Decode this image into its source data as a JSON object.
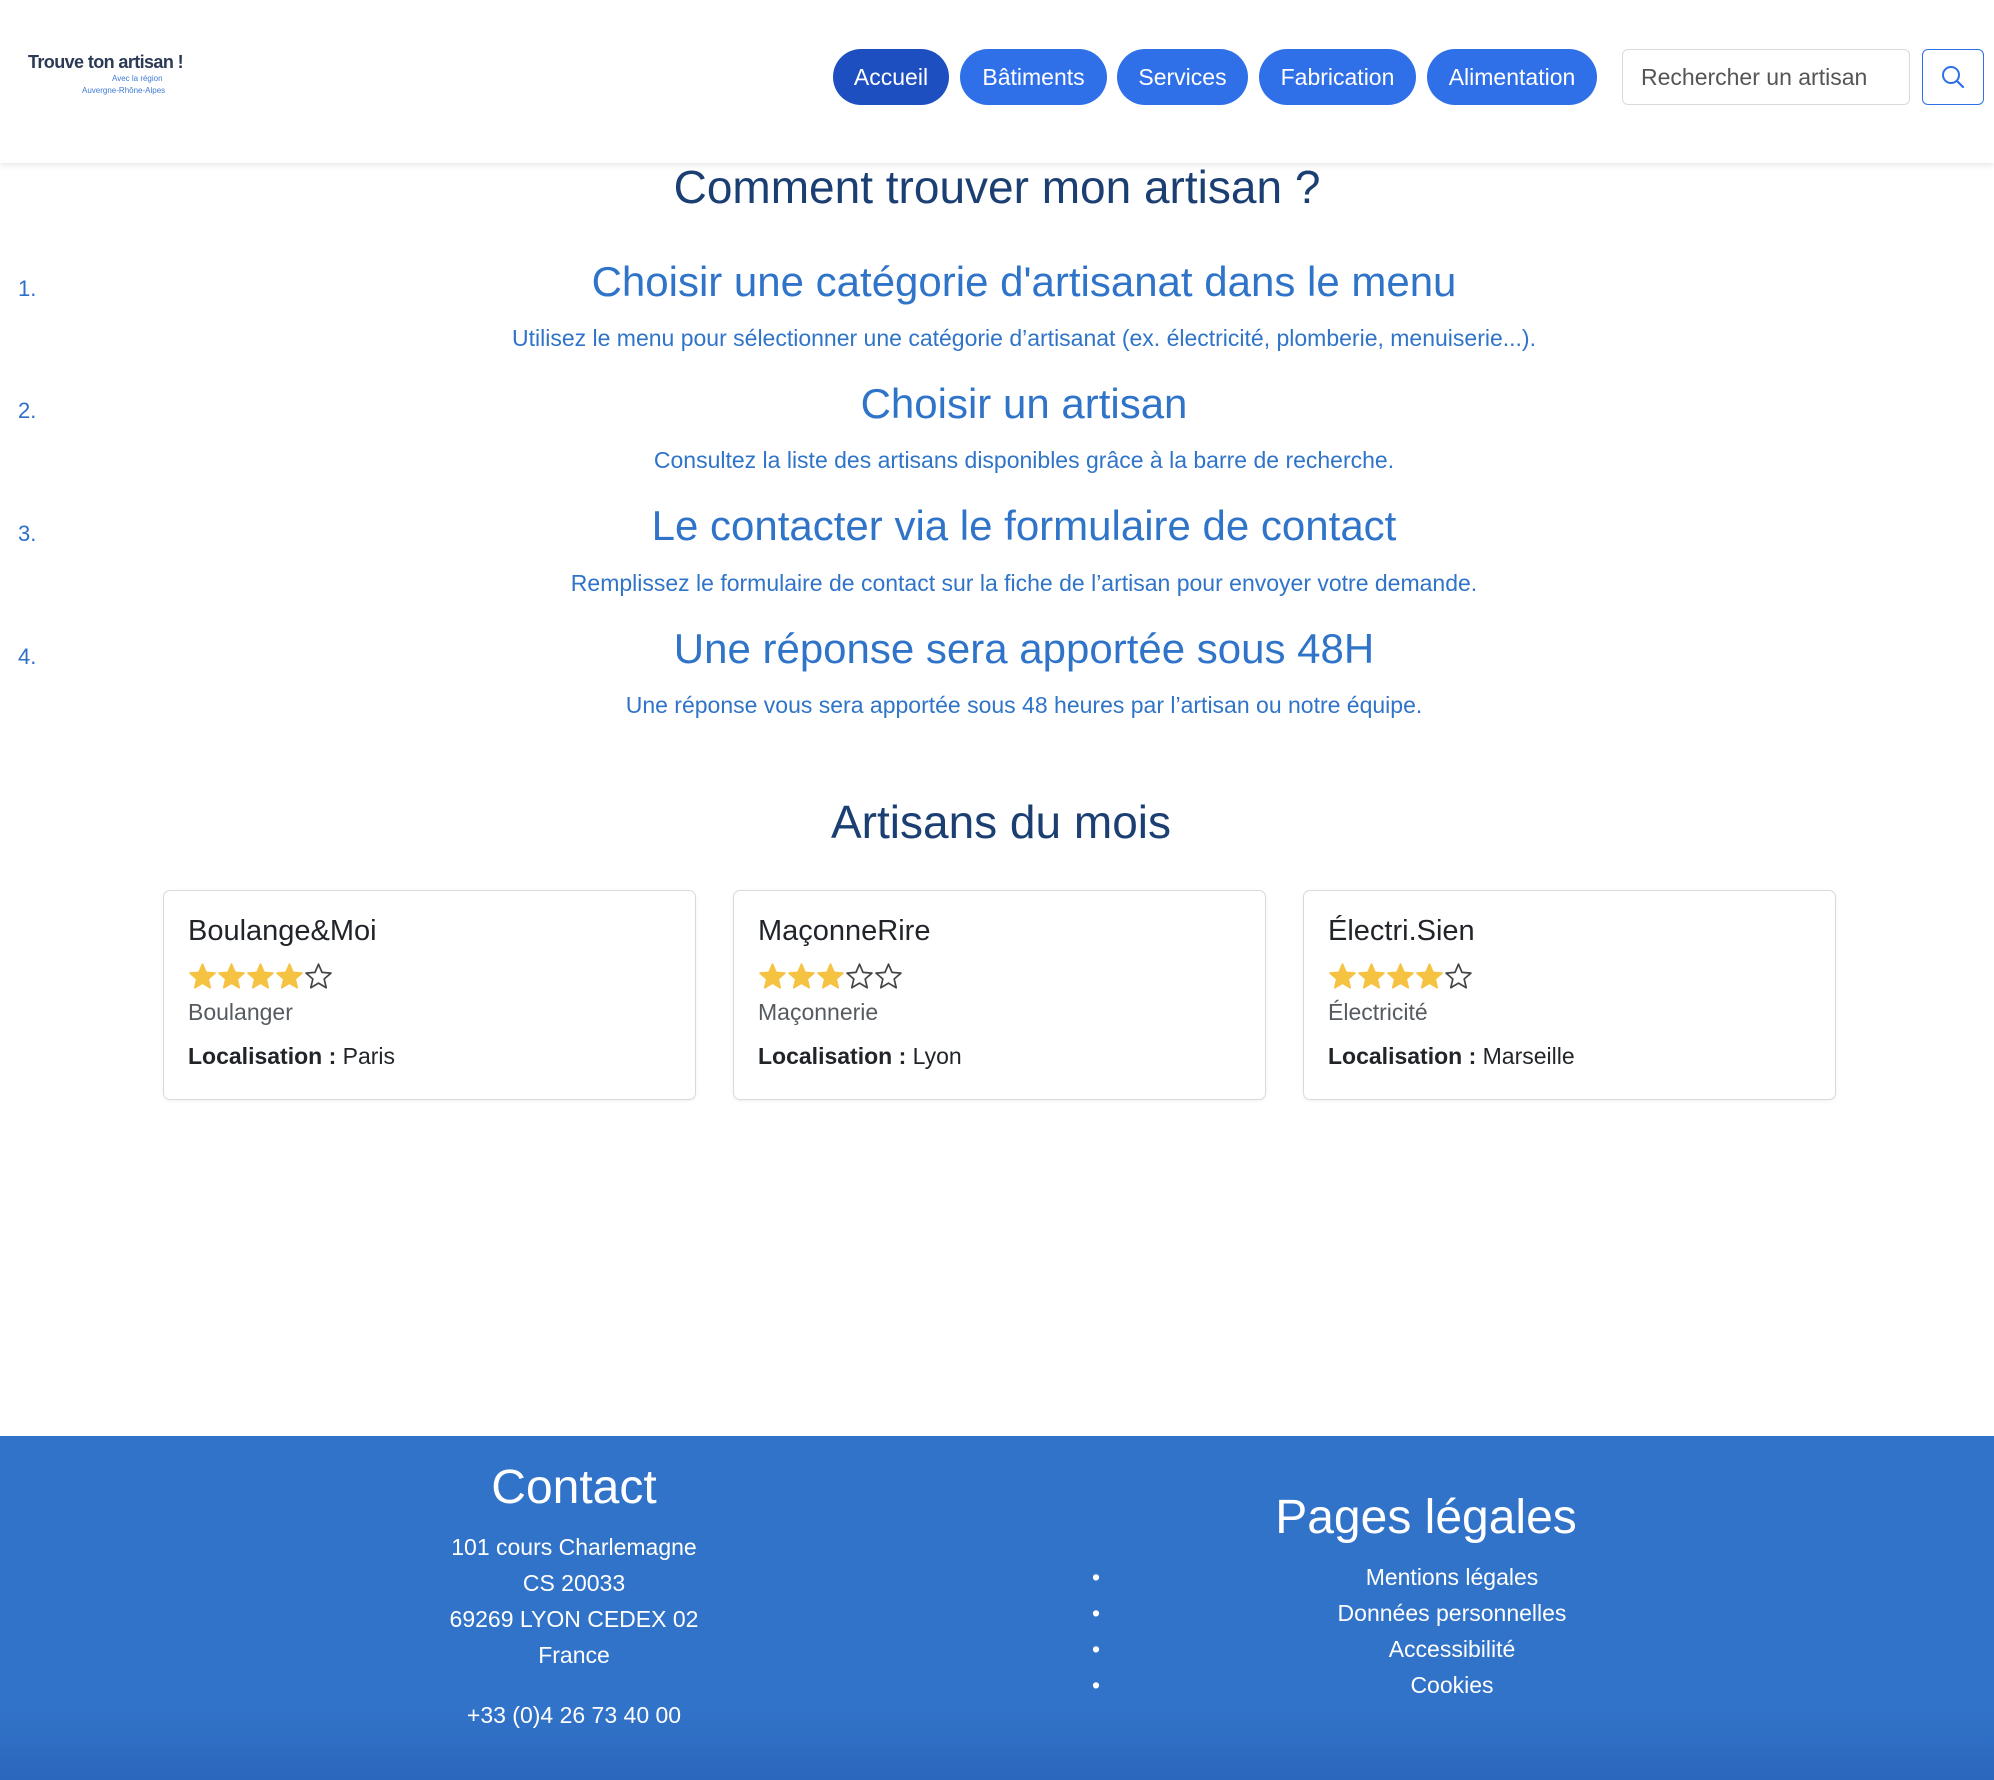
{
  "brand": {
    "title": "Trouve ton artisan !",
    "sub1": "Avec la région",
    "sub2": "Auvergne-Rhône-Alpes"
  },
  "nav": {
    "items": [
      {
        "label": "Accueil"
      },
      {
        "label": "Bâtiments"
      },
      {
        "label": "Services"
      },
      {
        "label": "Fabrication"
      },
      {
        "label": "Alimentation"
      }
    ],
    "search_placeholder": "Rechercher un artisan",
    "search_icon": "search-icon"
  },
  "guide": {
    "title": "Comment trouver mon artisan ?",
    "steps": [
      {
        "num": "1.",
        "title": "Choisir une catégorie d'artisanat dans le menu",
        "desc": "Utilisez le menu pour sélectionner une catégorie d’artisanat (ex. électricité, plomberie, menuiserie...)."
      },
      {
        "num": "2.",
        "title": "Choisir un artisan",
        "desc": "Consultez la liste des artisans disponibles grâce à la barre de recherche."
      },
      {
        "num": "3.",
        "title": "Le contacter via le formulaire de contact",
        "desc": "Remplissez le formulaire de contact sur la fiche de l’artisan pour envoyer votre demande."
      },
      {
        "num": "4.",
        "title": "Une réponse sera apportée sous 48H",
        "desc": "Une réponse vous sera apportée sous 48 heures par l’artisan ou notre équipe."
      }
    ]
  },
  "artisans": {
    "title": "Artisans du mois",
    "loc_label": "Localisation :",
    "items": [
      {
        "name": "Boulange&Moi",
        "rating": 4,
        "max_rating": 5,
        "category": "Boulanger",
        "location": "Paris"
      },
      {
        "name": "MaçonneRire",
        "rating": 3,
        "max_rating": 5,
        "category": "Maçonnerie",
        "location": "Lyon"
      },
      {
        "name": "Électri.Sien",
        "rating": 4,
        "max_rating": 5,
        "category": "Électricité",
        "location": "Marseille"
      }
    ]
  },
  "footer": {
    "contact": {
      "title": "Contact",
      "lines": [
        "101 cours Charlemagne",
        "CS 20033",
        "69269 LYON CEDEX 02",
        "France"
      ],
      "phone": "+33 (0)4 26 73 40 00"
    },
    "legal": {
      "title": "Pages légales",
      "links": [
        "Mentions légales",
        "Données personnelles",
        "Accessibilité",
        "Cookies"
      ]
    }
  },
  "colors": {
    "primary": "#2f6fe8",
    "primary_active": "#1d4fc0",
    "heading": "#1b3f72",
    "link": "#2f74c8",
    "footer_bg": "#3173c8",
    "star_filled": "#f5c242"
  }
}
